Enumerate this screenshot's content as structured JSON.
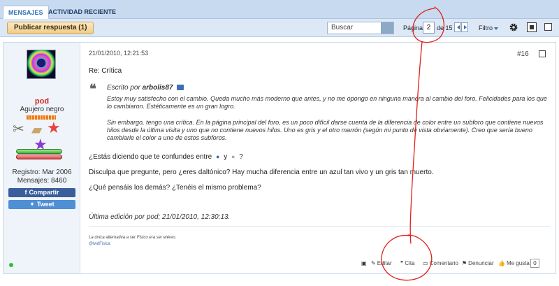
{
  "tabs": {
    "messages": "MENSAJES",
    "recent": "ACTIVIDAD RECIENTE"
  },
  "toolbar": {
    "reply_button": "Publicar respuesta (1)",
    "search_placeholder": "Buscar",
    "page_label": "Página",
    "page_current": "2",
    "page_of": "de 15",
    "filter_label": "Filtro"
  },
  "user": {
    "name": "pod",
    "title": "Agujero negro",
    "registered": "Registro: Mar 2006",
    "posts": "Mensajes: 8460",
    "share_facebook": "Compartir",
    "share_twitter": "Tweet"
  },
  "post": {
    "date": "21/01/2010, 12:21:53",
    "number": "#16",
    "subject": "Re: Crítica",
    "quote": {
      "prefix": "Escrito por",
      "author": "arbolis87",
      "paragraph1": "Estoy muy satisfecho con el cambio. Queda mucho más moderno que antes, y no me opongo en ninguna manera al cambio del foro. Felicidades para los que lo cambiaron. Estéticamente es un gran logro.",
      "paragraph2": "Sin embargo, tengo una crítica. En la página principal del foro, es un poco difícil darse cuenta de la diferencia de color entre un subforo que contiene nuevos hilos desde la última visita y uno que no contiene nuevos hilos. Uno es gris y el otro marrón (según mi punto de vista obviamente). Creo que sería bueno cambiarle el color a uno de estos subforos."
    },
    "line1_a": "¿Estás diciendo que te confundes entre",
    "line1_b": "y",
    "line1_c": "?",
    "line2": "Disculpa que pregunte, pero ¿eres daltónico? Hay mucha diferencia entre un azul tan vivo y un gris tan muerto.",
    "line3": "¿Qué pensáis los demás? ¿Tenéis el mismo problema?",
    "edit_note": "Última edición por pod; 21/01/2010, 12:30:13.",
    "signature1": "La única alternativa a ser Físico era ser etéreo.",
    "signature2": "@lwdFisica"
  },
  "actions": {
    "edit": "Editar",
    "quote": "Cita",
    "comment": "Comentario",
    "report": "Denunciar",
    "like": "Me gusta",
    "like_count": "0"
  },
  "colors": {
    "annotation": "#e0201a",
    "username": "#d1261b",
    "tab_strip": "#c7daf0"
  }
}
